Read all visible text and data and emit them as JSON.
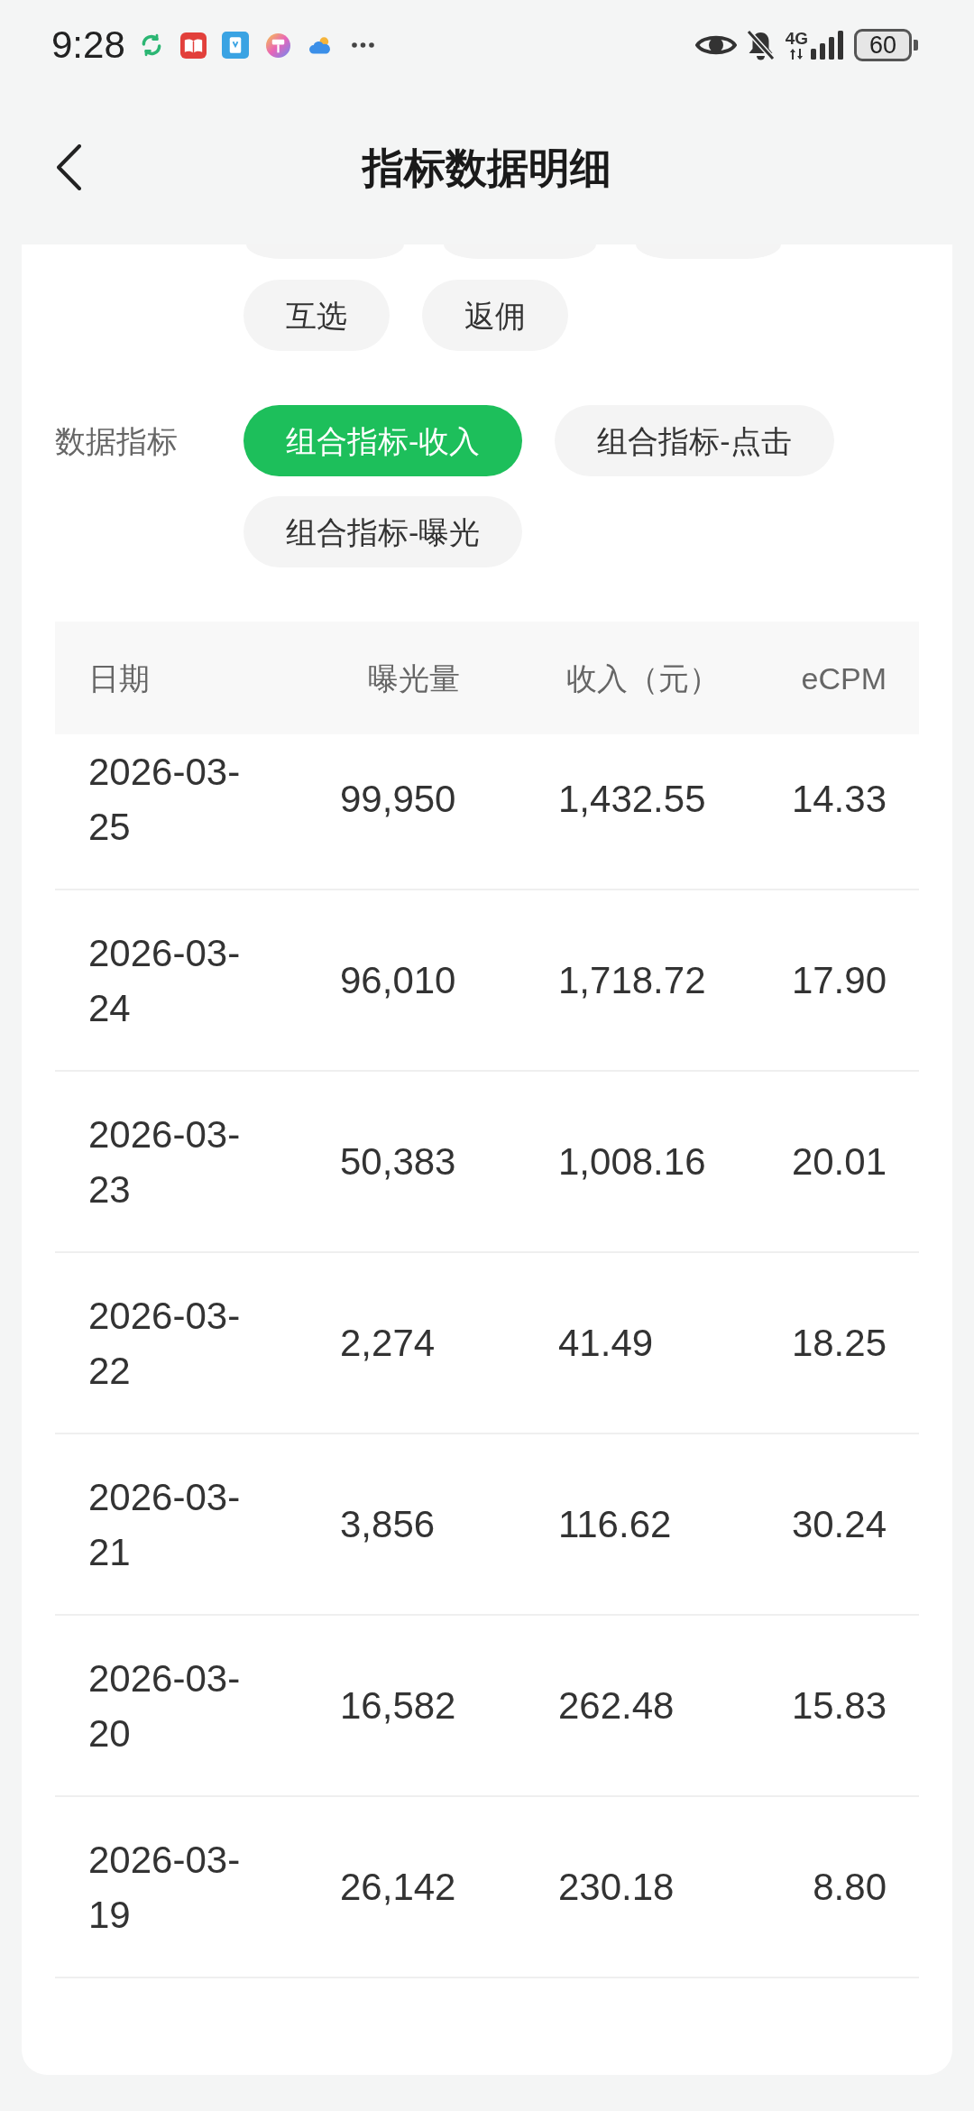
{
  "status_bar": {
    "time": "9:28",
    "network": "4G",
    "battery": "60"
  },
  "header": {
    "title": "指标数据明细"
  },
  "filter_groups": [
    {
      "options": [
        {
          "label": "互选",
          "selected": false
        },
        {
          "label": "返佣",
          "selected": false
        }
      ]
    },
    {
      "label": "数据指标",
      "options": [
        {
          "label": "组合指标-收入",
          "selected": true
        },
        {
          "label": "组合指标-点击",
          "selected": false
        },
        {
          "label": "组合指标-曝光",
          "selected": false
        }
      ]
    }
  ],
  "table": {
    "columns": [
      "日期",
      "曝光量",
      "收入（元）",
      "eCPM"
    ],
    "rows": [
      [
        "2026-03-25",
        "99,950",
        "1,432.55",
        "14.33"
      ],
      [
        "2026-03-24",
        "96,010",
        "1,718.72",
        "17.90"
      ],
      [
        "2026-03-23",
        "50,383",
        "1,008.16",
        "20.01"
      ],
      [
        "2026-03-22",
        "2,274",
        "41.49",
        "18.25"
      ],
      [
        "2026-03-21",
        "3,856",
        "116.62",
        "30.24"
      ],
      [
        "2026-03-20",
        "16,582",
        "262.48",
        "15.83"
      ],
      [
        "2026-03-19",
        "26,142",
        "230.18",
        "8.80"
      ]
    ]
  }
}
